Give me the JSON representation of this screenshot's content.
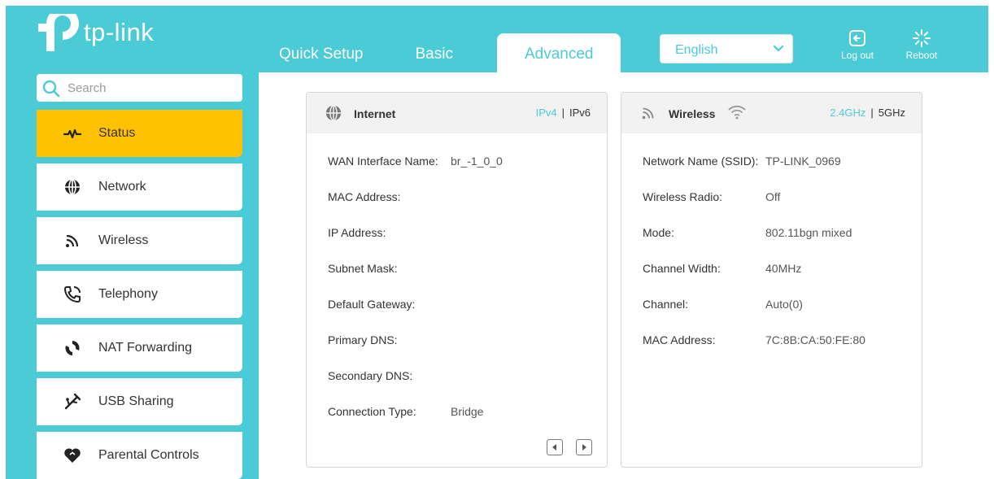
{
  "brand": {
    "name": "tp-link"
  },
  "nav": {
    "tabs": [
      {
        "label": "Quick Setup",
        "active": false
      },
      {
        "label": "Basic",
        "active": false
      },
      {
        "label": "Advanced",
        "active": true
      }
    ]
  },
  "language": {
    "selected": "English"
  },
  "header_actions": {
    "logout": "Log out",
    "reboot": "Reboot"
  },
  "search": {
    "placeholder": "Search"
  },
  "sidebar": {
    "items": [
      {
        "label": "Status",
        "icon": "status-pulse-icon",
        "active": true
      },
      {
        "label": "Network",
        "icon": "globe-icon",
        "active": false
      },
      {
        "label": "Wireless",
        "icon": "wireless-signal-icon",
        "active": false
      },
      {
        "label": "Telephony",
        "icon": "phone-icon",
        "active": false
      },
      {
        "label": "NAT Forwarding",
        "icon": "nat-icon",
        "active": false
      },
      {
        "label": "USB Sharing",
        "icon": "usb-icon",
        "active": false
      },
      {
        "label": "Parental Controls",
        "icon": "heart-icon",
        "active": false
      }
    ]
  },
  "internet": {
    "title": "Internet",
    "proto_active": "IPv4",
    "proto_inactive": "IPv6",
    "rows": [
      {
        "label": "WAN Interface Name:",
        "value": "br_-1_0_0"
      },
      {
        "label": "MAC Address:",
        "value": ""
      },
      {
        "label": "IP Address:",
        "value": ""
      },
      {
        "label": "Subnet Mask:",
        "value": ""
      },
      {
        "label": "Default Gateway:",
        "value": ""
      },
      {
        "label": "Primary DNS:",
        "value": ""
      },
      {
        "label": "Secondary DNS:",
        "value": ""
      },
      {
        "label": "Connection Type:",
        "value": "Bridge"
      }
    ]
  },
  "wireless": {
    "title": "Wireless",
    "band_active": "2.4GHz",
    "band_inactive": "5GHz",
    "rows": [
      {
        "label": "Network Name (SSID):",
        "value": "TP-LINK_0969"
      },
      {
        "label": "Wireless Radio:",
        "value": "Off"
      },
      {
        "label": "Mode:",
        "value": "802.11bgn mixed"
      },
      {
        "label": "Channel Width:",
        "value": "40MHz"
      },
      {
        "label": "Channel:",
        "value": "Auto(0)"
      },
      {
        "label": "MAC Address:",
        "value": "7C:8B:CA:50:FE:80"
      }
    ]
  },
  "colors": {
    "accent": "#4acbd6",
    "active_item": "#ffc200"
  }
}
